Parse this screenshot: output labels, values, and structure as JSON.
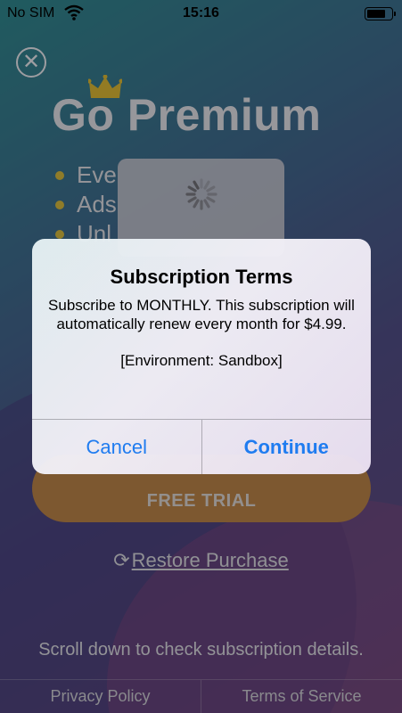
{
  "status_bar": {
    "carrier": "No SIM",
    "time": "15:16"
  },
  "paywall": {
    "title": "Go Premium",
    "features": [
      "Eve",
      "Ads",
      "Unl"
    ],
    "free_trial_label": "FREE TRIAL",
    "restore_label": "Restore Purchase",
    "scroll_hint": "Scroll down to check subscription details.",
    "footer": {
      "privacy": "Privacy Policy",
      "terms": "Terms of Service"
    }
  },
  "alert": {
    "title": "Subscription Terms",
    "message": "Subscribe to MONTHLY. This subscription will automatically renew every month for $4.99.",
    "environment": "[Environment: Sandbox]",
    "cancel_label": "Cancel",
    "continue_label": "Continue"
  },
  "colors": {
    "accent": "#1f7cf0",
    "trial_button": "#a56a22",
    "bullet": "#c2a317"
  }
}
